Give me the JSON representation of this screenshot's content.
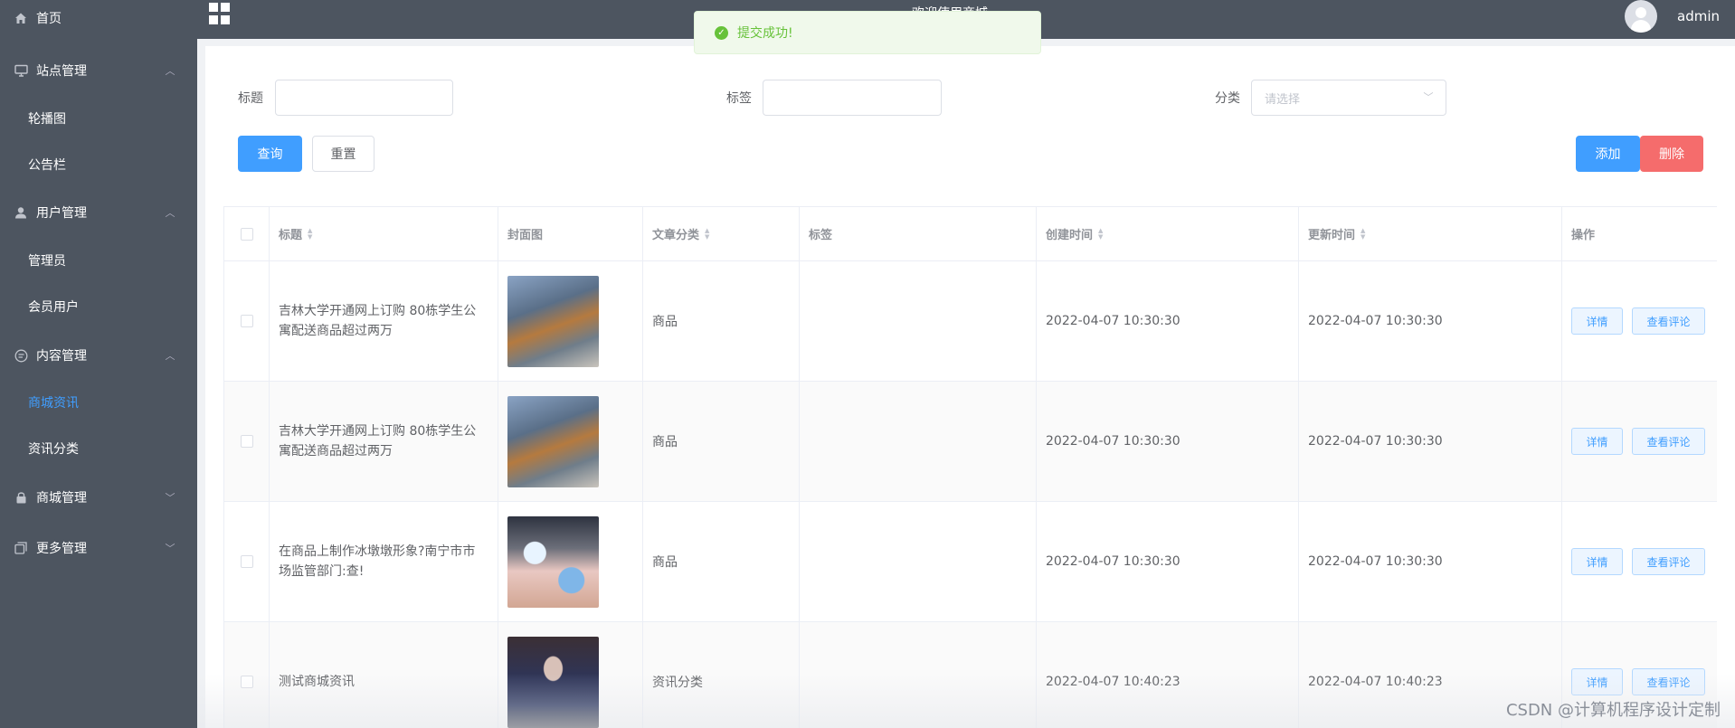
{
  "sidebar": {
    "items": [
      {
        "label": "首页",
        "icon": "home-icon"
      },
      {
        "label": "站点管理",
        "icon": "monitor-icon"
      },
      {
        "label": "轮播图"
      },
      {
        "label": "公告栏"
      },
      {
        "label": "用户管理",
        "icon": "user-icon"
      },
      {
        "label": "管理员"
      },
      {
        "label": "会员用户"
      },
      {
        "label": "内容管理",
        "icon": "chat-icon"
      },
      {
        "label": "商城资讯"
      },
      {
        "label": "资讯分类"
      },
      {
        "label": "商城管理",
        "icon": "lock-icon"
      },
      {
        "label": "更多管理",
        "icon": "copy-icon"
      }
    ],
    "active_color": "#409eff"
  },
  "header": {
    "title": "欢迎使用商城",
    "user": "admin"
  },
  "toast": {
    "message": "提交成功!",
    "type": "success"
  },
  "filters": {
    "title_label": "标题",
    "tag_label": "标签",
    "category_label": "分类",
    "category_placeholder": "请选择"
  },
  "buttons": {
    "query": "查询",
    "reset": "重置",
    "add": "添加",
    "delete": "删除"
  },
  "table": {
    "columns": [
      "标题",
      "封面图",
      "文章分类",
      "标签",
      "创建时间",
      "更新时间",
      "操作"
    ],
    "rows": [
      {
        "title": "吉林大学开通网上订购 80栋学生公寓配送商品超过两万",
        "category": "商品",
        "tag": "",
        "created": "2022-04-07 10:30:30",
        "updated": "2022-04-07 10:30:30"
      },
      {
        "title": "吉林大学开通网上订购 80栋学生公寓配送商品超过两万",
        "category": "商品",
        "tag": "",
        "created": "2022-04-07 10:30:30",
        "updated": "2022-04-07 10:30:30"
      },
      {
        "title": "在商品上制作冰墩墩形象?南宁市市场监管部门:查!",
        "category": "商品",
        "tag": "",
        "created": "2022-04-07 10:30:30",
        "updated": "2022-04-07 10:30:30"
      },
      {
        "title": "测试商城资讯",
        "category": "资讯分类",
        "tag": "",
        "created": "2022-04-07 10:40:23",
        "updated": "2022-04-07 10:40:23"
      }
    ],
    "actions": {
      "detail": "详情",
      "comments": "查看评论"
    }
  },
  "watermark": "CSDN @计算机程序设计定制"
}
